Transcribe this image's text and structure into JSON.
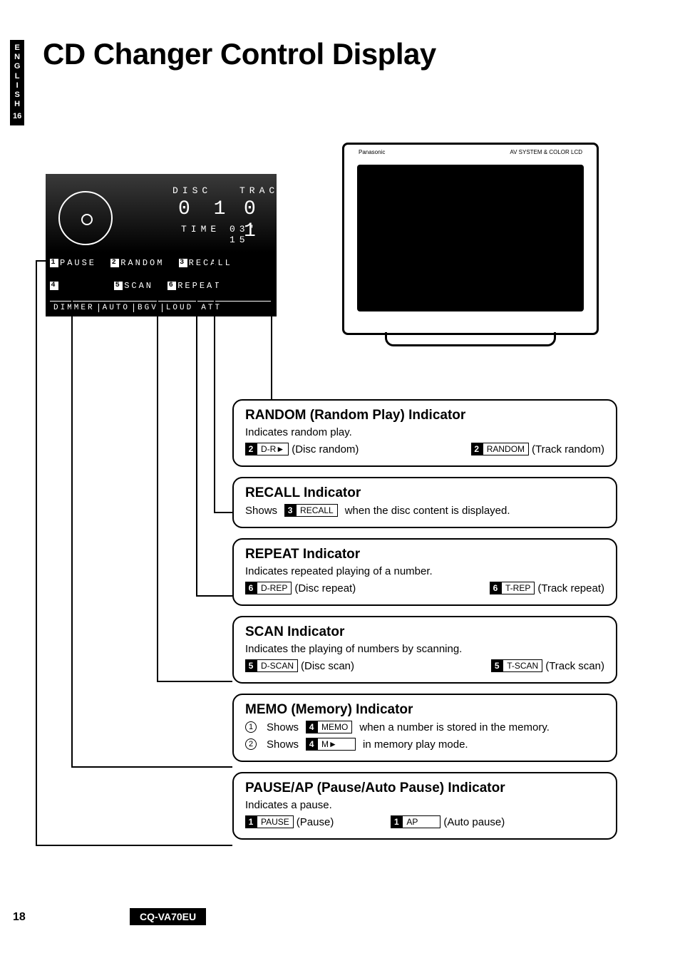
{
  "lang_tab": {
    "letters": "ENGLISH",
    "page_ref": "16"
  },
  "title": "CD Changer Control Display",
  "lcd": {
    "disc_label": "DISC",
    "track_label": "TRACK",
    "disc_value": "0 1",
    "track_value": "0 1",
    "time_label": "TIME",
    "time_value": "03' 15",
    "row1": [
      {
        "n": "1",
        "t": "PAUSE"
      },
      {
        "n": "2",
        "t": "RANDOM"
      },
      {
        "n": "3",
        "t": "RECALL"
      }
    ],
    "row2": [
      {
        "n": "4",
        "t": ""
      },
      {
        "n": "5",
        "t": "SCAN"
      },
      {
        "n": "6",
        "t": "REPEAT"
      }
    ],
    "status": [
      "DIMMER",
      "AUTO",
      "BGV",
      "LOUD",
      "ATT"
    ]
  },
  "monitor": {
    "brand_left": "Panasonic",
    "brand_right": "AV SYSTEM & COLOR LCD"
  },
  "callouts": [
    {
      "title": "RANDOM (Random Play) Indicator",
      "desc": "Indicates random play.",
      "tags": [
        {
          "n": "2",
          "box": "D-R►",
          "label": "(Disc random)"
        },
        {
          "n": "2",
          "box": "RANDOM",
          "label": "(Track random)"
        }
      ]
    },
    {
      "title": "RECALL Indicator",
      "desc_pre": "Shows",
      "tags": [
        {
          "n": "3",
          "box": "RECALL",
          "label": "when the disc content is displayed."
        }
      ]
    },
    {
      "title": "REPEAT Indicator",
      "desc": "Indicates repeated playing of a number.",
      "tags": [
        {
          "n": "6",
          "box": "D-REP",
          "label": "(Disc repeat)"
        },
        {
          "n": "6",
          "box": "T-REP",
          "label": "(Track repeat)"
        }
      ]
    },
    {
      "title": "SCAN Indicator",
      "desc": "Indicates the playing of numbers by scanning.",
      "tags": [
        {
          "n": "5",
          "box": "D-SCAN",
          "label": "(Disc scan)"
        },
        {
          "n": "5",
          "box": "T-SCAN",
          "label": "(Track scan)"
        }
      ]
    },
    {
      "title": "MEMO (Memory) Indicator",
      "lines": [
        {
          "circ": "1",
          "pre": "Shows",
          "n": "4",
          "box": "MEMO",
          "post": "when a number is stored in the memory."
        },
        {
          "circ": "2",
          "pre": "Shows",
          "n": "4",
          "box": "M►",
          "post": "in memory play mode."
        }
      ]
    },
    {
      "title": "PAUSE/AP (Pause/Auto Pause) Indicator",
      "desc": "Indicates a pause.",
      "tags": [
        {
          "n": "1",
          "box": "PAUSE",
          "label": "(Pause)"
        },
        {
          "n": "1",
          "box": "AP",
          "label": "(Auto pause)"
        }
      ]
    }
  ],
  "footer": {
    "page": "18",
    "model": "CQ-VA70EU"
  }
}
